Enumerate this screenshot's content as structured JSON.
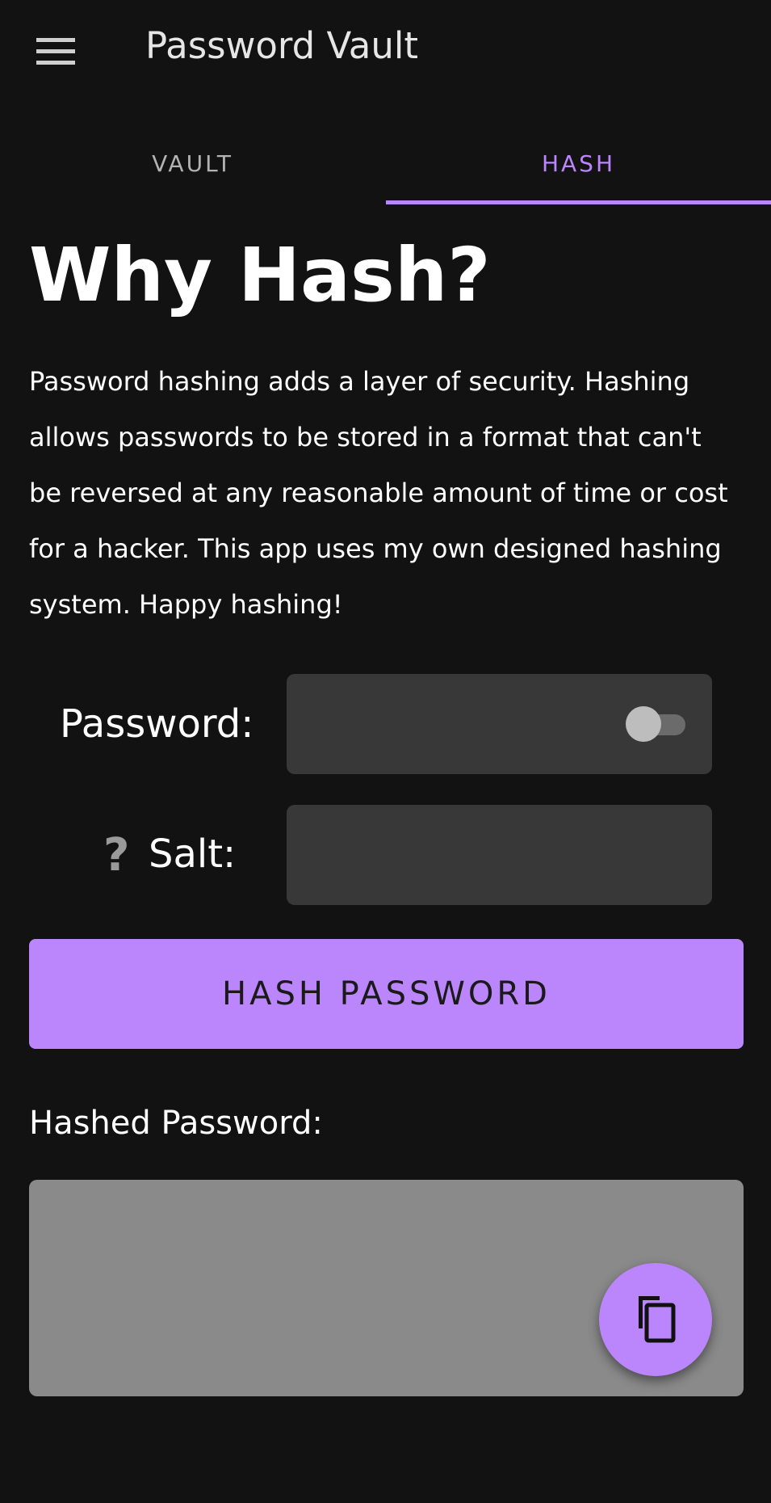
{
  "app_bar": {
    "title": "Password Vault",
    "menu_icon": "hamburger-menu-icon"
  },
  "tabs": [
    {
      "label": "VAULT",
      "selected": false
    },
    {
      "label": "HASH",
      "selected": true
    }
  ],
  "main": {
    "heading": "Why Hash?",
    "description": "Password hashing adds a layer of security. Hashing allows passwords to be stored in a format that can't be reversed at any reasonable amount of time or cost for a hacker. This app uses my own designed hashing system. Happy hashing!",
    "password_label": "Password:",
    "password_value": "",
    "password_visibility_toggle": false,
    "salt_help_icon": "question-mark-icon",
    "salt_help_glyph": "?",
    "salt_label": "Salt:",
    "salt_value": "",
    "hash_button_label": "HASH PASSWORD",
    "result_label": "Hashed Password:",
    "result_value": "",
    "copy_icon": "copy-icon"
  },
  "colors": {
    "background": "#121212",
    "accent": "#bb86fc",
    "field_background": "#383838",
    "result_background": "#8a8a8a",
    "text": "#ffffff"
  }
}
